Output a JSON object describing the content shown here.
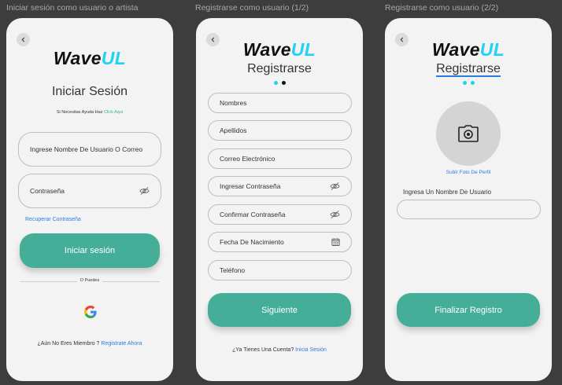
{
  "frames": {
    "login": "Iniciar sesión como usuario o artista",
    "register1": "Registrarse como usuario (1/2)",
    "register2": "Registrarse como usuario (2/2)"
  },
  "logo": {
    "part1": "Wave",
    "part2": "UL"
  },
  "login": {
    "title": "Iniciar Sesión",
    "help_text": "Si Necesitas Ayuda Haz",
    "help_link": "Click Aqui",
    "username_placeholder": "Ingrese Nombre De Usuario O Correo",
    "password_placeholder": "Contraseña",
    "recover_link": "Recuperar Contraseña",
    "submit_label": "Iniciar sesión",
    "divider_text": "O Puedes",
    "signup_prompt": "¿Aún No Eres Miembro ?",
    "signup_link": "Registrate Ahora"
  },
  "register1": {
    "title": "Registrarse",
    "fields": {
      "nombres": "Nombres",
      "apellidos": "Apellidos",
      "correo": "Correo Electrónico",
      "contrasena": "Ingresar Contraseña",
      "confirmar": "Confirmar Contraseña",
      "fecha": "Fecha De Nacimiento",
      "telefono": "Teléfono"
    },
    "next_label": "Siguiente",
    "login_prompt": "¿Ya Tienes Una Cuenta?",
    "login_link": "Inicia Sesión"
  },
  "register2": {
    "title": "Registrarse",
    "upload_label": "Subir Foto De Perfil",
    "username_label": "Ingresa Un Nombre De Usuario",
    "finish_label": "Finalizar Registro"
  },
  "colors": {
    "accent_green": "#44ae98",
    "logo_cyan": "#1fd3f2",
    "link_blue": "#2a7de1",
    "background": "#3d3d3d"
  },
  "icons": [
    "back-arrow-icon",
    "eye-off-icon",
    "google-icon",
    "calendar-icon",
    "camera-icon"
  ]
}
